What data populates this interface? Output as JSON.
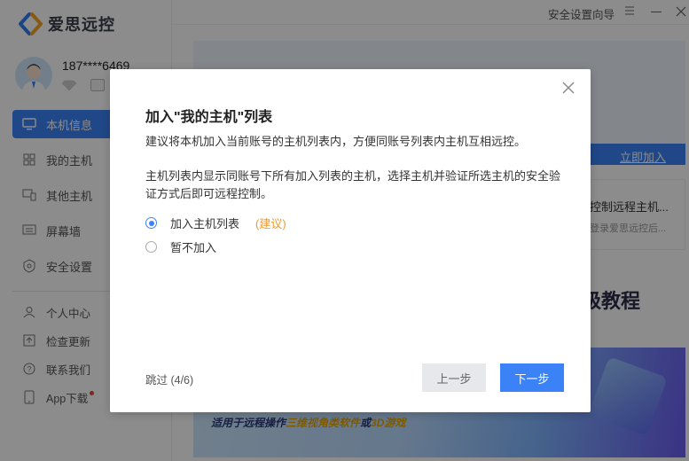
{
  "app": {
    "name": "爱思远控"
  },
  "user": {
    "phone": "187****6469"
  },
  "sidebar": {
    "items": [
      {
        "label": "本机信息",
        "icon": "monitor-icon",
        "active": true
      },
      {
        "label": "我的主机",
        "icon": "grid-icon"
      },
      {
        "label": "其他主机",
        "icon": "devices-icon"
      },
      {
        "label": "屏幕墙",
        "icon": "screen-wall-icon"
      },
      {
        "label": "安全设置",
        "icon": "shield-icon"
      }
    ],
    "secondary": [
      {
        "label": "个人中心",
        "icon": "person-icon"
      },
      {
        "label": "检查更新",
        "icon": "update-icon"
      },
      {
        "label": "联系我们",
        "icon": "help-icon"
      },
      {
        "label": "App下载",
        "icon": "phone-icon",
        "badge": true
      }
    ]
  },
  "topbar": {
    "guide_link": "安全设置向导"
  },
  "main": {
    "join_link": "立即加入",
    "card_title": "控制远程主机...",
    "card_subtitle": "登录爱思远控后...",
    "tutorial_text": "级教程",
    "promo": {
      "prefix": "适用于远程操作",
      "highlight1": "三维视角类软件",
      "mid": "或",
      "highlight2": "3D游戏"
    }
  },
  "dialog": {
    "title": "加入\"我的主机\"列表",
    "paragraph1": "建议将本机加入当前账号的主机列表内，方便同账号列表内主机互相远控。",
    "paragraph2": "主机列表内显示同账号下所有加入列表的主机，选择主机并验证所选主机的安全验证方式后即可远程控制。",
    "options": [
      {
        "label": "加入主机列表",
        "suggest": "(建议)",
        "selected": true
      },
      {
        "label": "暂不加入",
        "selected": false
      }
    ],
    "skip": "跳过 (4/6)",
    "prev_button": "上一步",
    "next_button": "下一步"
  },
  "colors": {
    "accent": "#3b82f6",
    "suggest": "#f19a2b",
    "badge": "#f0413b"
  }
}
